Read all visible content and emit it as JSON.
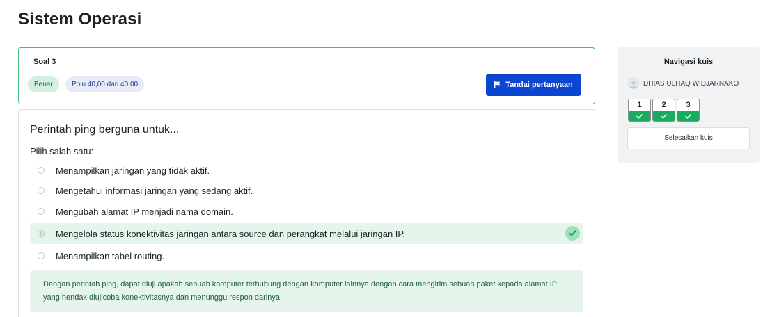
{
  "page": {
    "title": "Sistem Operasi"
  },
  "question_info": {
    "number_label": "Soal 3",
    "state_badge": "Benar",
    "grade_badge": "Poin 40,00 dari 40,00",
    "flag_button": "Tandai pertanyaan"
  },
  "question": {
    "text": "Perintah ping berguna untuk...",
    "prompt": "Pilih salah satu:",
    "answers": [
      {
        "label": "Menampilkan jaringan yang tidak aktif.",
        "selected": false,
        "correct": false
      },
      {
        "label": "Mengetahui informasi jaringan yang sedang aktif.",
        "selected": false,
        "correct": false
      },
      {
        "label": "Mengubah alamat IP menjadi nama domain.",
        "selected": false,
        "correct": false
      },
      {
        "label": "Mengelola status konektivitas jaringan antara source dan perangkat melalui jaringan IP.",
        "selected": true,
        "correct": true
      },
      {
        "label": "Menampilkan tabel routing.",
        "selected": false,
        "correct": false
      }
    ],
    "feedback": "Dengan perintah ping, dapat diuji apakah sebuah komputer terhubung dengan komputer lainnya dengan cara mengirim sebuah paket kepada alamat IP yang hendak diujicoba konektivitasnya dan menunggu respon darinya."
  },
  "quiz_nav": {
    "title": "Navigasi kuis",
    "user_name": "DHIAS ULHAQ WIDJARNAKO",
    "questions": [
      {
        "number": "1",
        "state": "correct"
      },
      {
        "number": "2",
        "state": "correct"
      },
      {
        "number": "3",
        "state": "correct"
      }
    ],
    "finish_button": "Selesaikan kuis"
  },
  "colors": {
    "accent_blue": "#0b45d1",
    "correct_green": "#1aab5e",
    "correct_bg": "#e6f5ec",
    "info_border": "#3fbf7f"
  }
}
